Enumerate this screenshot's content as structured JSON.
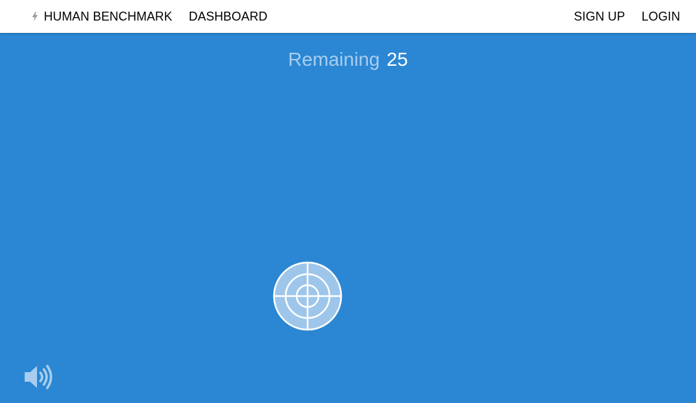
{
  "nav": {
    "brand_label": "HUMAN BENCHMARK",
    "dashboard_label": "DASHBOARD",
    "signup_label": "SIGN UP",
    "login_label": "LOGIN"
  },
  "game": {
    "remaining_label": "Remaining",
    "remaining_count": "25"
  },
  "icons": {
    "brand": "lightning-bolt-icon",
    "target": "crosshair-target-icon",
    "sound": "speaker-volume-icon"
  },
  "colors": {
    "background": "#2b87d3",
    "navbar": "#ffffff",
    "target_fill": "#9dc6ea",
    "muted_text": "#a8cdef"
  }
}
